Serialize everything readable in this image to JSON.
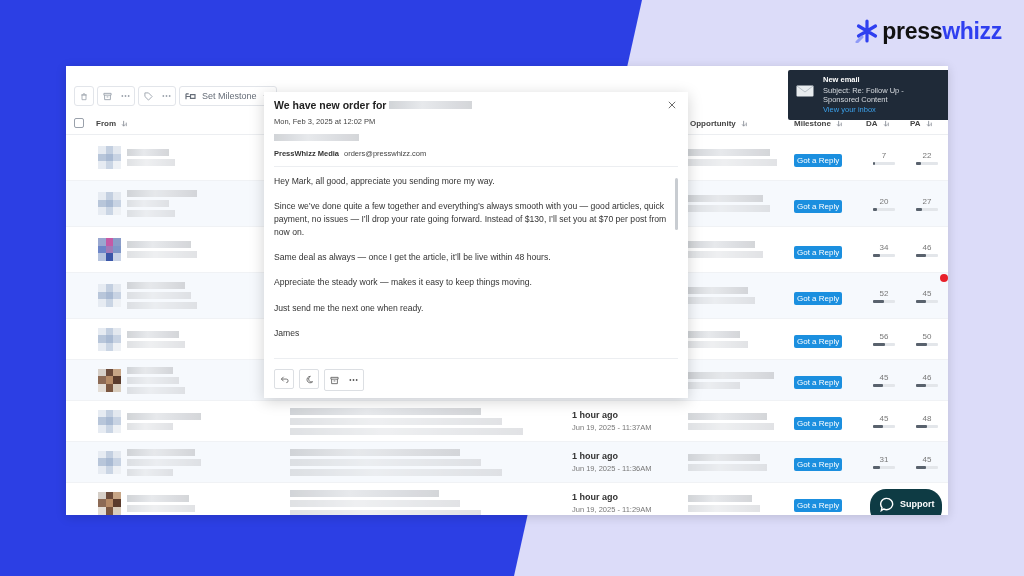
{
  "logo": {
    "prefix": "press",
    "suffix": "whizz"
  },
  "toolbar": {
    "milestone_button": "Set Milestone"
  },
  "table": {
    "select_all": {
      "checked": false
    },
    "columns": {
      "from": "From",
      "opportunity": "Opportunity",
      "milestone": "Milestone",
      "da": "DA",
      "pa": "PA"
    },
    "rows": [
      {
        "milestone": "Got a Reply",
        "da": {
          "value": "7",
          "level": 0.07
        },
        "pa": {
          "value": "22",
          "level": 0.22
        }
      },
      {
        "milestone": "Got a Reply",
        "da": {
          "value": "20",
          "level": 0.2
        },
        "pa": {
          "value": "27",
          "level": 0.27
        }
      },
      {
        "milestone": "Got a Reply",
        "da": {
          "value": "34",
          "level": 0.34
        },
        "pa": {
          "value": "46",
          "level": 0.46
        }
      },
      {
        "milestone": "Got a Reply",
        "da": {
          "value": "52",
          "level": 0.52
        },
        "pa": {
          "value": "45",
          "level": 0.45
        }
      },
      {
        "milestone": "Got a Reply",
        "da": {
          "value": "56",
          "level": 0.56
        },
        "pa": {
          "value": "50",
          "level": 0.5
        }
      },
      {
        "milestone": "Got a Reply",
        "da": {
          "value": "45",
          "level": 0.45
        },
        "pa": {
          "value": "46",
          "level": 0.46
        }
      },
      {
        "received": {
          "relative": "1 hour ago",
          "date": "Jun 19, 2025 - 11:37AM"
        },
        "milestone": "Got a Reply",
        "da": {
          "value": "45",
          "level": 0.45
        },
        "pa": {
          "value": "48",
          "level": 0.48
        }
      },
      {
        "received": {
          "relative": "1 hour ago",
          "date": "Jun 19, 2025 - 11:36AM"
        },
        "milestone": "Got a Reply",
        "da": {
          "value": "31",
          "level": 0.31
        },
        "pa": {
          "value": "45",
          "level": 0.45
        }
      },
      {
        "received": {
          "relative": "1 hour ago",
          "date": "Jun 19, 2025 - 11:29AM"
        },
        "milestone": "Got a Reply"
      }
    ]
  },
  "email": {
    "title": "We have new order for",
    "date": "Mon, Feb 3, 2025 at 12:02 PM",
    "sender_name": "PressWhizz Media",
    "sender_email": "orders@presswhizz.com",
    "body": [
      "Hey Mark, all good, appreciate you sending more my way.",
      "Since we’ve done quite a few together and everything’s always smooth with you — good articles, quick payment, no issues — I’ll drop your rate going forward. Instead of $130, I’ll set you at $70 per post from now on.",
      "Same deal as always — once I get the article, it’ll be live within 48 hours.",
      "Appreciate the steady work — makes it easy to keep things moving.",
      "Just send me the next one when ready.",
      "James"
    ]
  },
  "notification": {
    "title": "New email",
    "subject": "Subject: Re: Follow Up - Sponsored Content",
    "link": "View your inbox"
  },
  "support": {
    "label": "Support"
  }
}
